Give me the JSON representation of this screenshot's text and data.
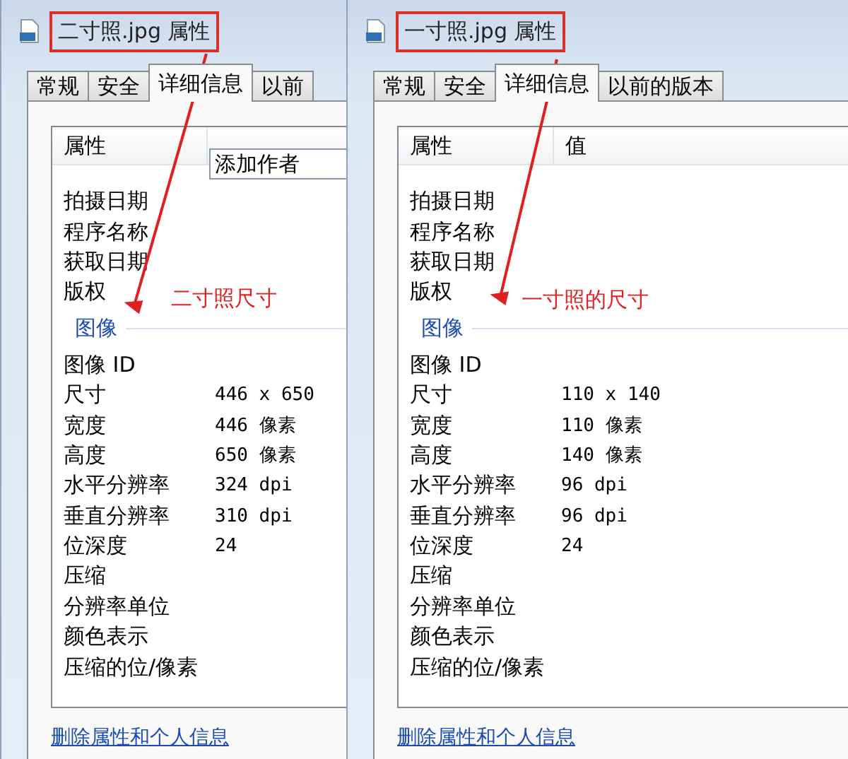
{
  "dialogs": [
    {
      "title": "二寸照.jpg 属性",
      "title_highlighted": true,
      "tabs": [
        {
          "label": "常规",
          "selected": false
        },
        {
          "label": "安全",
          "selected": false
        },
        {
          "label": "详细信息",
          "selected": true
        },
        {
          "label": "以前",
          "selected": false
        }
      ],
      "columns": [
        "属性"
      ],
      "author_field": {
        "value": "添加作者"
      },
      "rows": [
        {
          "name": "拍摄日期"
        },
        {
          "name": "程序名称"
        },
        {
          "name": "获取日期"
        },
        {
          "name": "版权"
        }
      ],
      "group": "图像",
      "image_rows": [
        {
          "name": "图像 ID"
        },
        {
          "name": "尺寸",
          "value": "446 x 650"
        },
        {
          "name": "宽度",
          "value": "446 像素"
        },
        {
          "name": "高度",
          "value": "650 像素"
        },
        {
          "name": "水平分辨率",
          "value": "324 dpi"
        },
        {
          "name": "垂直分辨率",
          "value": "310 dpi"
        },
        {
          "name": "位深度",
          "value": "24"
        },
        {
          "name": "压缩"
        },
        {
          "name": "分辨率单位"
        },
        {
          "name": "颜色表示"
        },
        {
          "name": "压缩的位/像素"
        }
      ],
      "link": "删除属性和个人信息",
      "annotation": "二寸照尺寸"
    },
    {
      "title": "一寸照.jpg 属性",
      "title_highlighted": true,
      "tabs": [
        {
          "label": "常规",
          "selected": false
        },
        {
          "label": "安全",
          "selected": false
        },
        {
          "label": "详细信息",
          "selected": true
        },
        {
          "label": "以前的版本",
          "selected": false
        }
      ],
      "columns": [
        "属性",
        "值"
      ],
      "rows": [
        {
          "name": "拍摄日期"
        },
        {
          "name": "程序名称"
        },
        {
          "name": "获取日期"
        },
        {
          "name": "版权"
        }
      ],
      "group": "图像",
      "image_rows": [
        {
          "name": "图像 ID"
        },
        {
          "name": "尺寸",
          "value": "110 x 140"
        },
        {
          "name": "宽度",
          "value": "110 像素"
        },
        {
          "name": "高度",
          "value": "140 像素"
        },
        {
          "name": "水平分辨率",
          "value": "96 dpi"
        },
        {
          "name": "垂直分辨率",
          "value": "96 dpi"
        },
        {
          "name": "位深度",
          "value": "24"
        },
        {
          "name": "压缩"
        },
        {
          "name": "分辨率单位"
        },
        {
          "name": "颜色表示"
        },
        {
          "name": "压缩的位/像素"
        }
      ],
      "link": "删除属性和个人信息",
      "annotation": "一寸照的尺寸"
    }
  ]
}
